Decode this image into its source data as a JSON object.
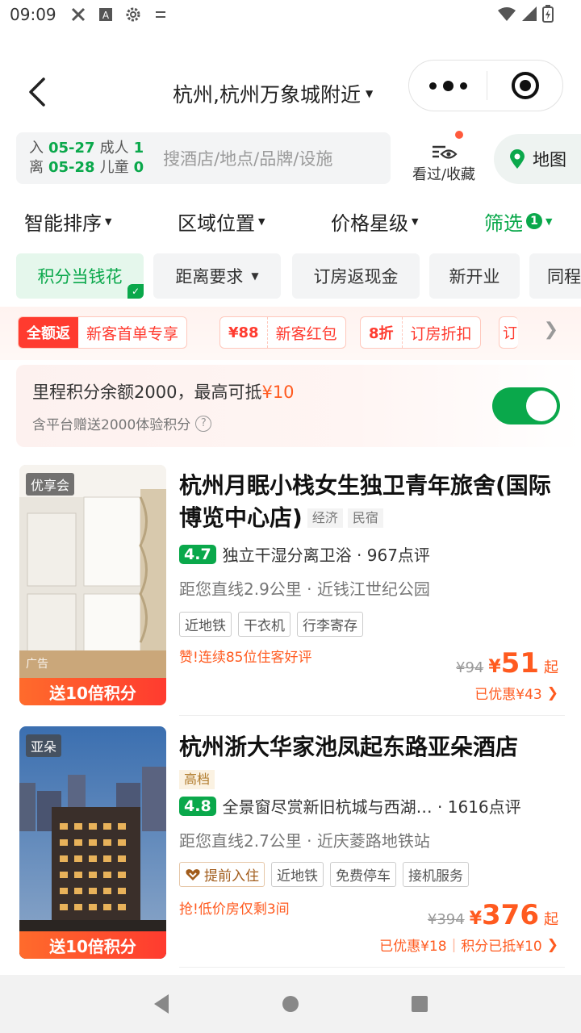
{
  "status_bar": {
    "time": "09:09",
    "icons": [
      "signal-tool-icon",
      "a-icon",
      "gear-icon",
      "tune-icon"
    ],
    "right_icons": [
      "wifi-icon",
      "cell-signal-icon",
      "battery-charging-icon"
    ]
  },
  "header": {
    "location": "杭州,杭州万象城附近",
    "capsule_icons": [
      "more-icon",
      "target-icon"
    ]
  },
  "search": {
    "checkin_label": "入",
    "checkin_date": "05-27",
    "checkout_label": "离",
    "checkout_date": "05-28",
    "adult_label": "成人",
    "adult_count": "1",
    "child_label": "儿童",
    "child_count": "0",
    "placeholder": "搜酒店/地点/品牌/设施",
    "history_label": "看过/收藏",
    "map_label": "地图"
  },
  "sort_tabs": [
    {
      "label": "智能排序"
    },
    {
      "label": "区域位置"
    },
    {
      "label": "价格星级"
    },
    {
      "label": "筛选",
      "badge": "1"
    }
  ],
  "chips": [
    {
      "label": "积分当钱花",
      "selected": true
    },
    {
      "label": "距离要求"
    },
    {
      "label": "订房返现金"
    },
    {
      "label": "新开业"
    },
    {
      "label": "同程"
    }
  ],
  "promos": [
    {
      "left": "全额返",
      "right": "新客首单专享"
    },
    {
      "left": "¥88",
      "right": "新客红包"
    },
    {
      "left": "8折",
      "right": "订房折扣"
    },
    {
      "left": "订"
    }
  ],
  "points_card": {
    "title": "里程积分余额2000，最高可抵",
    "amount": "¥10",
    "subtitle": "含平台赠送2000体验积分",
    "toggle_on": true
  },
  "hotels": [
    {
      "name": "杭州月眠小栈女生独卫青年旅舍(国际博览中心店)",
      "tags": [
        "经济",
        "民宿"
      ],
      "thumb_tag": "优享会",
      "ad_label": "广告",
      "points_banner": "送10倍积分",
      "score": "4.7",
      "review_summary": "独立干湿分离卫浴 · 967点评",
      "distance": "距您直线2.9公里 · 近钱江世纪公园",
      "facilities": [
        "近地铁",
        "干衣机",
        "行李寄存"
      ],
      "highlight": "赞!连续85位住客好评",
      "price_old": "¥94",
      "price_symbol": "¥",
      "price": "51",
      "price_suffix": "起",
      "discount": "已优惠¥43",
      "discount_extra": ""
    },
    {
      "name": "杭州浙大华家池凤起东路亚朵酒店",
      "tags": [
        "高档"
      ],
      "thumb_tag": "亚朵",
      "points_banner": "送10倍积分",
      "score": "4.8",
      "review_summary": "全景窗尽赏新旧杭城与西湖… · 1616点评",
      "distance": "距您直线2.7公里 · 近庆菱路地铁站",
      "facilities": [
        "提前入住",
        "近地铁",
        "免费停车",
        "接机服务"
      ],
      "highlight": "抢!低价房仅剩3间",
      "price_old": "¥394",
      "price_symbol": "¥",
      "price": "376",
      "price_suffix": "起",
      "discount": "已优惠¥18",
      "discount_extra": "积分已抵¥10"
    }
  ],
  "nav_bar": {
    "icons": [
      "back-triangle-icon",
      "home-circle-icon",
      "recents-square-icon"
    ]
  },
  "colors": {
    "brand_green": "#0aa84b",
    "price_orange": "#ff5a1f",
    "promo_red": "#ff3b2f"
  }
}
